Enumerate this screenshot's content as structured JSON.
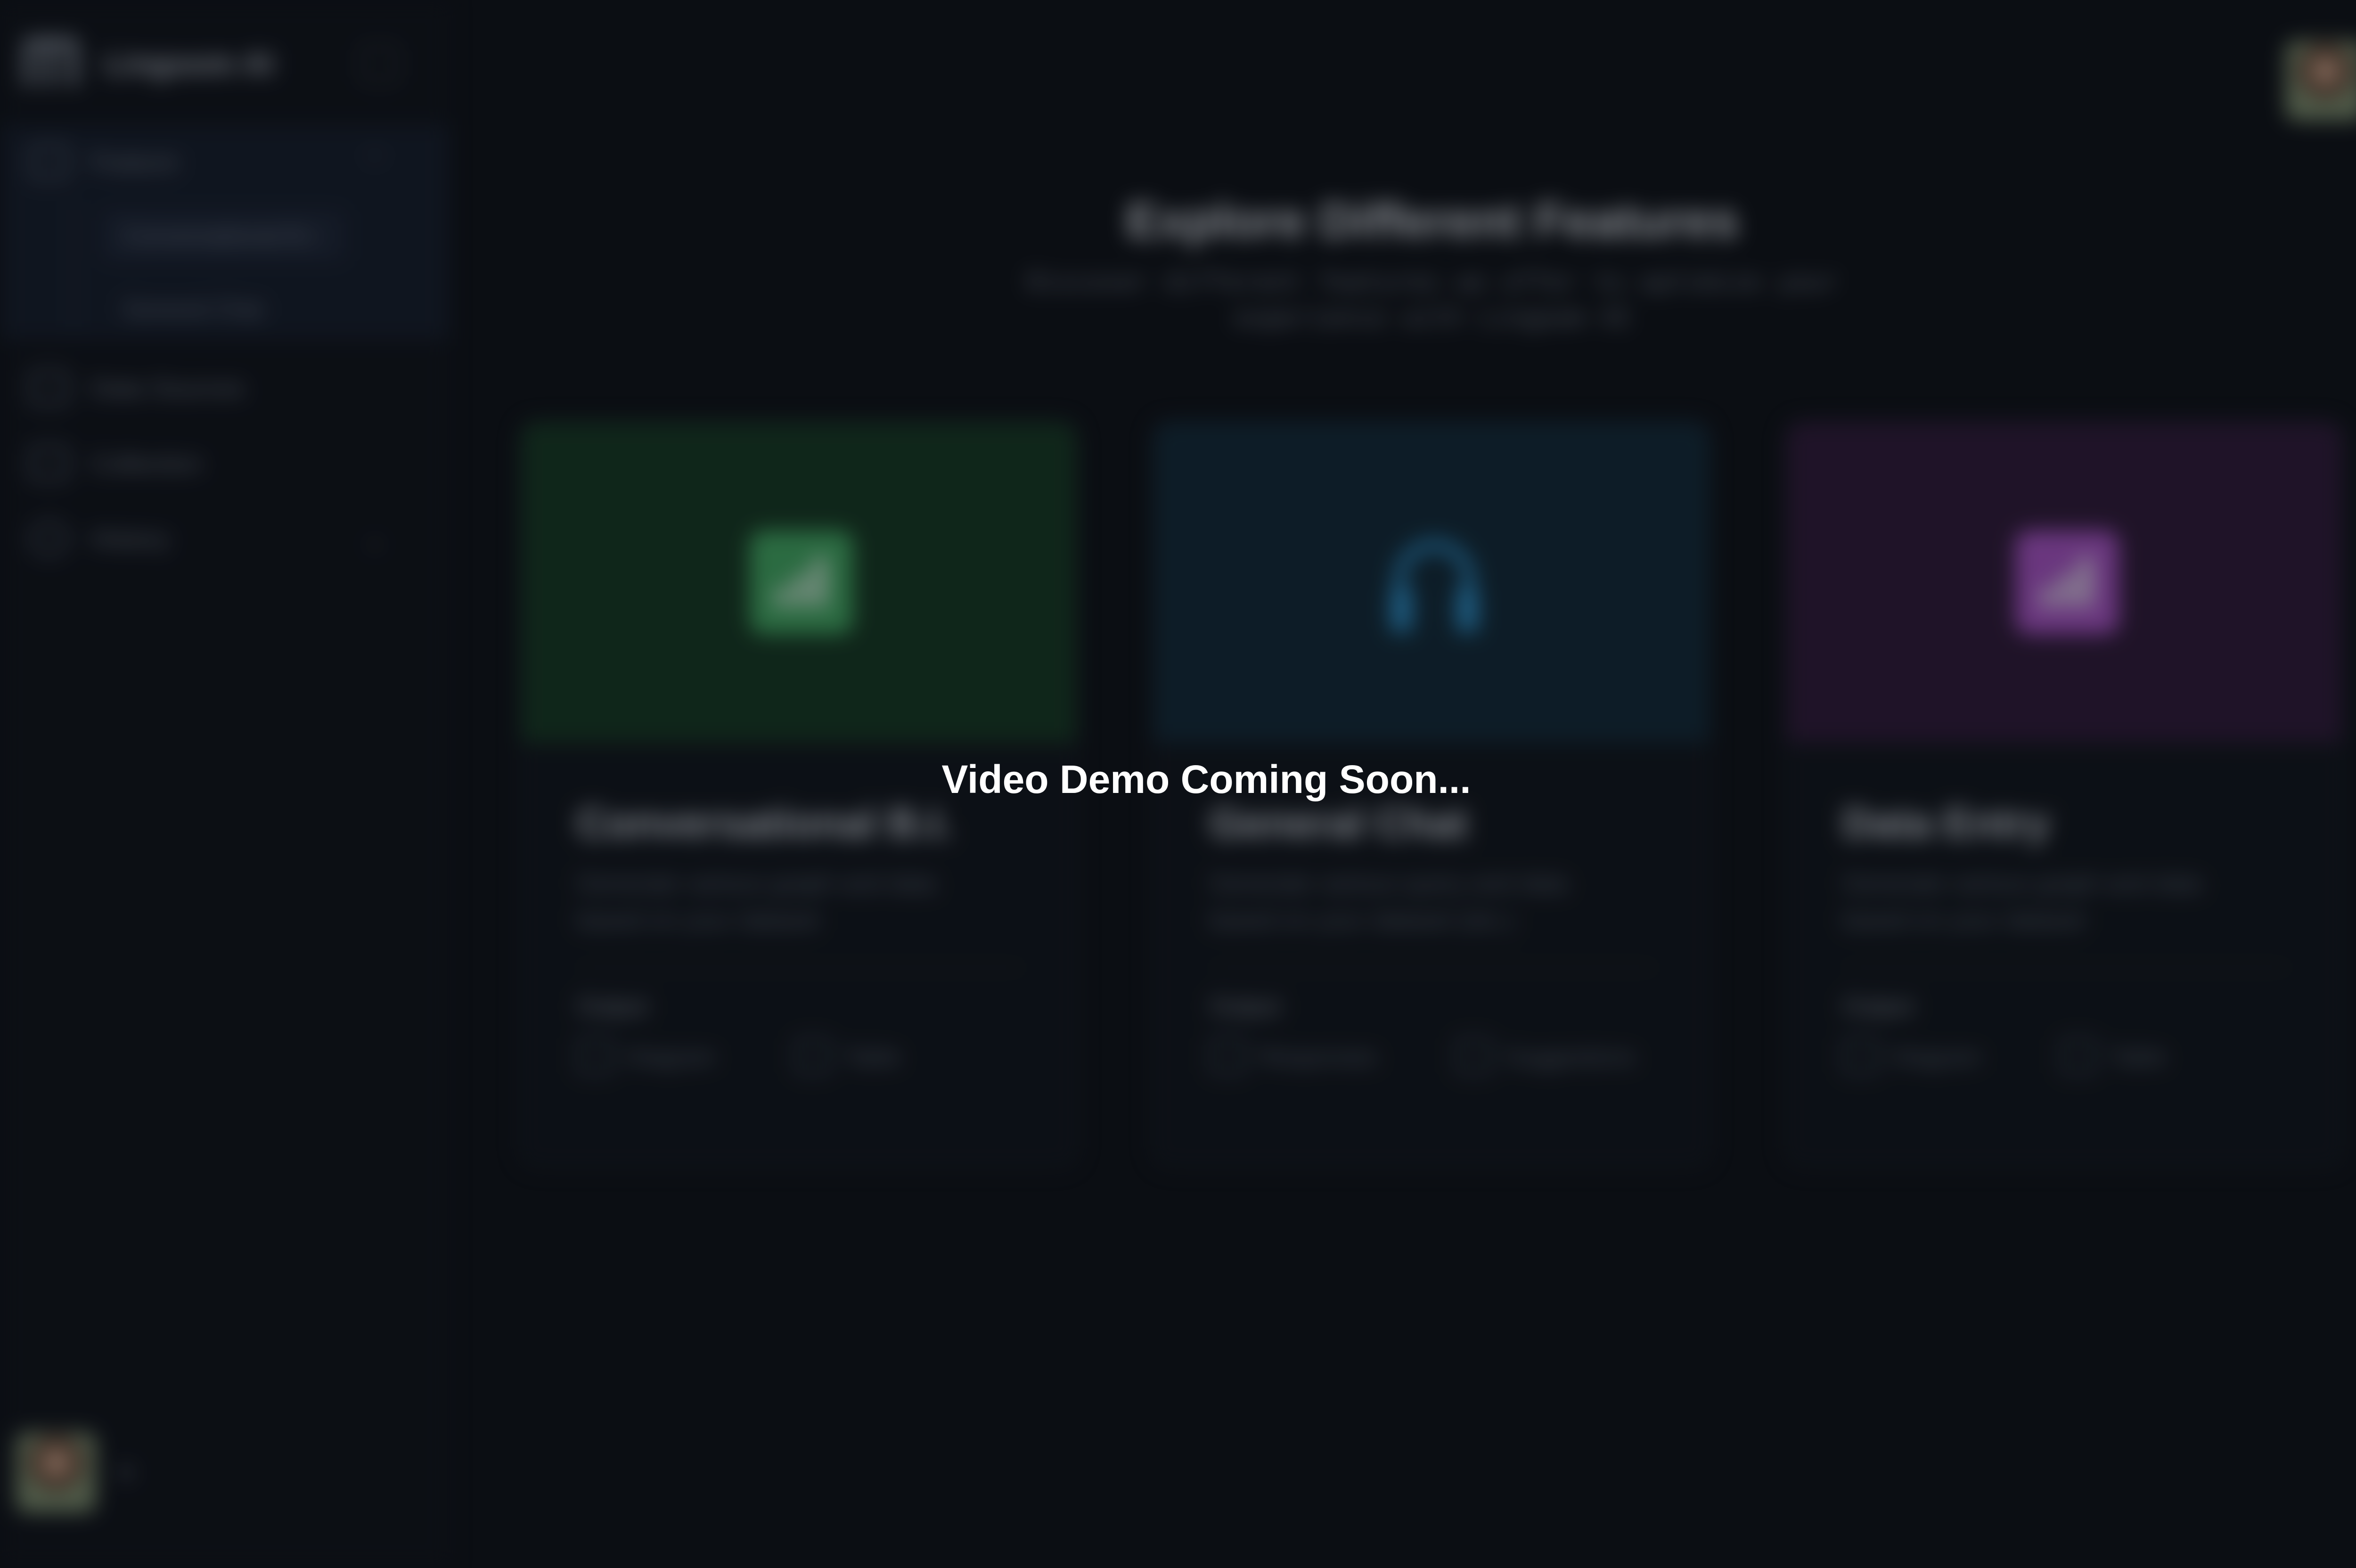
{
  "brand": {
    "name": "Lingoom AI"
  },
  "sidebar": {
    "items": [
      {
        "label": "Feature",
        "children": [
          {
            "label": "Conversational B.I."
          },
          {
            "label": "General Chat"
          }
        ]
      },
      {
        "label": "Data Sources"
      },
      {
        "label": "Collection"
      },
      {
        "label": "History"
      }
    ],
    "profile_caret": "▾"
  },
  "main": {
    "title": "Explore Different Features",
    "subtitle": "Discover different features we offer to optimize your experience with Lingoom AI",
    "cards": [
      {
        "title": "Conversational B.I.",
        "description": "Generate various graph and data based on your dataset",
        "output_label": "Output",
        "outputs": [
          "Diagram",
          "Table"
        ],
        "accent": "#3fa45e",
        "icon": "bar-chart-icon"
      },
      {
        "title": "General Chat",
        "description": "Generate various query and data based on your dataset (etc.)",
        "output_label": "Output",
        "outputs": [
          "Responses",
          "Suggestions"
        ],
        "accent": "#2a8cc4",
        "icon": "headset-icon"
      },
      {
        "title": "Data Entry",
        "description": "Generate various graph and data based on your dataset",
        "output_label": "Output",
        "outputs": [
          "Diagram",
          "Table"
        ],
        "accent": "#a450c0",
        "icon": "bar-chart-icon"
      }
    ]
  },
  "overlay": {
    "message": "Video Demo Coming Soon..."
  }
}
